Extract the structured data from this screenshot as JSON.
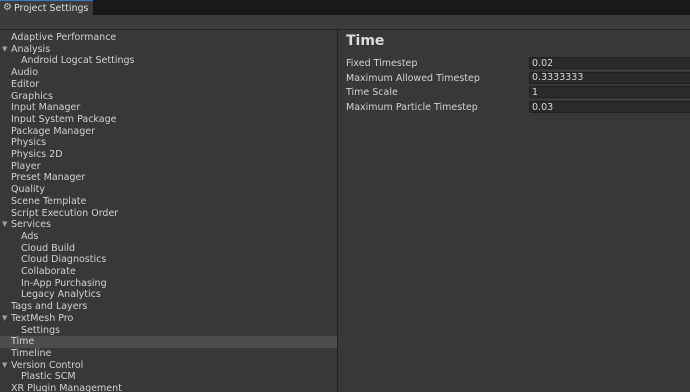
{
  "window": {
    "tab_title": "Project Settings"
  },
  "sidebar": {
    "items": [
      {
        "label": "Adaptive Performance",
        "level": 0,
        "expanded": null,
        "selected": false
      },
      {
        "label": "Analysis",
        "level": 0,
        "expanded": true,
        "selected": false
      },
      {
        "label": "Android Logcat Settings",
        "level": 1,
        "expanded": null,
        "selected": false
      },
      {
        "label": "Audio",
        "level": 0,
        "expanded": null,
        "selected": false
      },
      {
        "label": "Editor",
        "level": 0,
        "expanded": null,
        "selected": false
      },
      {
        "label": "Graphics",
        "level": 0,
        "expanded": null,
        "selected": false
      },
      {
        "label": "Input Manager",
        "level": 0,
        "expanded": null,
        "selected": false
      },
      {
        "label": "Input System Package",
        "level": 0,
        "expanded": null,
        "selected": false
      },
      {
        "label": "Package Manager",
        "level": 0,
        "expanded": null,
        "selected": false
      },
      {
        "label": "Physics",
        "level": 0,
        "expanded": null,
        "selected": false
      },
      {
        "label": "Physics 2D",
        "level": 0,
        "expanded": null,
        "selected": false
      },
      {
        "label": "Player",
        "level": 0,
        "expanded": null,
        "selected": false
      },
      {
        "label": "Preset Manager",
        "level": 0,
        "expanded": null,
        "selected": false
      },
      {
        "label": "Quality",
        "level": 0,
        "expanded": null,
        "selected": false
      },
      {
        "label": "Scene Template",
        "level": 0,
        "expanded": null,
        "selected": false
      },
      {
        "label": "Script Execution Order",
        "level": 0,
        "expanded": null,
        "selected": false
      },
      {
        "label": "Services",
        "level": 0,
        "expanded": true,
        "selected": false
      },
      {
        "label": "Ads",
        "level": 1,
        "expanded": null,
        "selected": false
      },
      {
        "label": "Cloud Build",
        "level": 1,
        "expanded": null,
        "selected": false
      },
      {
        "label": "Cloud Diagnostics",
        "level": 1,
        "expanded": null,
        "selected": false
      },
      {
        "label": "Collaborate",
        "level": 1,
        "expanded": null,
        "selected": false
      },
      {
        "label": "In-App Purchasing",
        "level": 1,
        "expanded": null,
        "selected": false
      },
      {
        "label": "Legacy Analytics",
        "level": 1,
        "expanded": null,
        "selected": false
      },
      {
        "label": "Tags and Layers",
        "level": 0,
        "expanded": null,
        "selected": false
      },
      {
        "label": "TextMesh Pro",
        "level": 0,
        "expanded": true,
        "selected": false
      },
      {
        "label": "Settings",
        "level": 1,
        "expanded": null,
        "selected": false
      },
      {
        "label": "Time",
        "level": 0,
        "expanded": null,
        "selected": true
      },
      {
        "label": "Timeline",
        "level": 0,
        "expanded": null,
        "selected": false
      },
      {
        "label": "Version Control",
        "level": 0,
        "expanded": true,
        "selected": false
      },
      {
        "label": "Plastic SCM",
        "level": 1,
        "expanded": null,
        "selected": false
      },
      {
        "label": "XR Plugin Management",
        "level": 0,
        "expanded": null,
        "selected": false
      }
    ]
  },
  "main": {
    "title": "Time",
    "fields": [
      {
        "label": "Fixed Timestep",
        "value": "0.02"
      },
      {
        "label": "Maximum Allowed Timestep",
        "value": "0.3333333"
      },
      {
        "label": "Time Scale",
        "value": "1"
      },
      {
        "label": "Maximum Particle Timestep",
        "value": "0.03"
      }
    ]
  },
  "colors": {
    "background": "#383838",
    "selected_row": "#4d4d4d",
    "field_bg": "#2a2a2a",
    "tab_accent": "#3a79bb"
  }
}
